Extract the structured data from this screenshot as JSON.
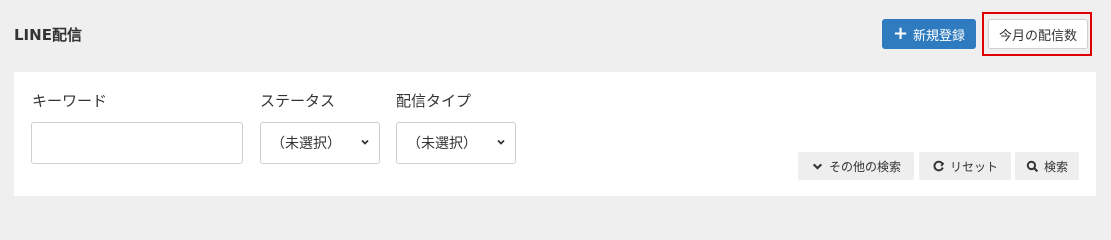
{
  "header": {
    "title": "LINE配信",
    "new_button_label": "新規登録",
    "new_button_icon": "plus-icon",
    "month_count_button_label": "今月の配信数",
    "highlight_color": "#e00000",
    "primary_color": "#2f7bbf"
  },
  "search": {
    "keyword": {
      "label": "キーワード",
      "value": ""
    },
    "status": {
      "label": "ステータス",
      "selected": "（未選択）"
    },
    "delivery_type": {
      "label": "配信タイプ",
      "selected": "（未選択）"
    },
    "actions": {
      "other_search": {
        "label": "その他の検索",
        "icon": "chevron-down-icon"
      },
      "reset": {
        "label": "リセット",
        "icon": "refresh-icon"
      },
      "search": {
        "label": "検索",
        "icon": "search-icon"
      }
    }
  }
}
